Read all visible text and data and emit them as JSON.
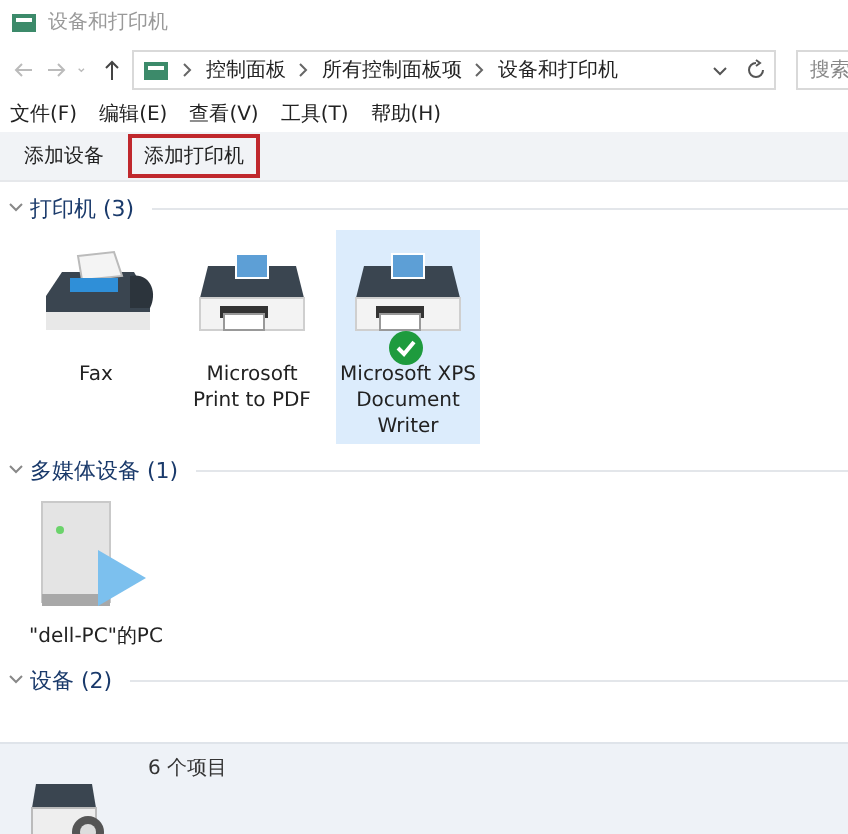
{
  "window": {
    "title": "设备和打印机"
  },
  "address_bar": {
    "crumbs": [
      "控制面板",
      "所有控制面板项",
      "设备和打印机"
    ],
    "search": {
      "placeholder": "搜索"
    }
  },
  "menu": [
    "文件(F)",
    "编辑(E)",
    "查看(V)",
    "工具(T)",
    "帮助(H)"
  ],
  "commands": [
    {
      "label": "添加设备",
      "highlighted": false
    },
    {
      "label": "添加打印机",
      "highlighted": true
    }
  ],
  "groups": [
    {
      "title": "打印机 (3)",
      "expanded": true,
      "items": [
        {
          "kind": "fax",
          "label": "Fax",
          "selected": false,
          "default": false
        },
        {
          "kind": "printer",
          "label": "Microsoft Print to PDF",
          "selected": false,
          "default": false
        },
        {
          "kind": "printer",
          "label": "Microsoft XPS Document Writer",
          "selected": true,
          "default": true
        }
      ]
    },
    {
      "title": "多媒体设备 (1)",
      "expanded": true,
      "items": [
        {
          "kind": "media",
          "label": "\"dell-PC\"的PC",
          "selected": false,
          "default": false
        }
      ]
    },
    {
      "title": "设备 (2)",
      "expanded": true
    }
  ],
  "details": {
    "count": "6 个项目"
  }
}
